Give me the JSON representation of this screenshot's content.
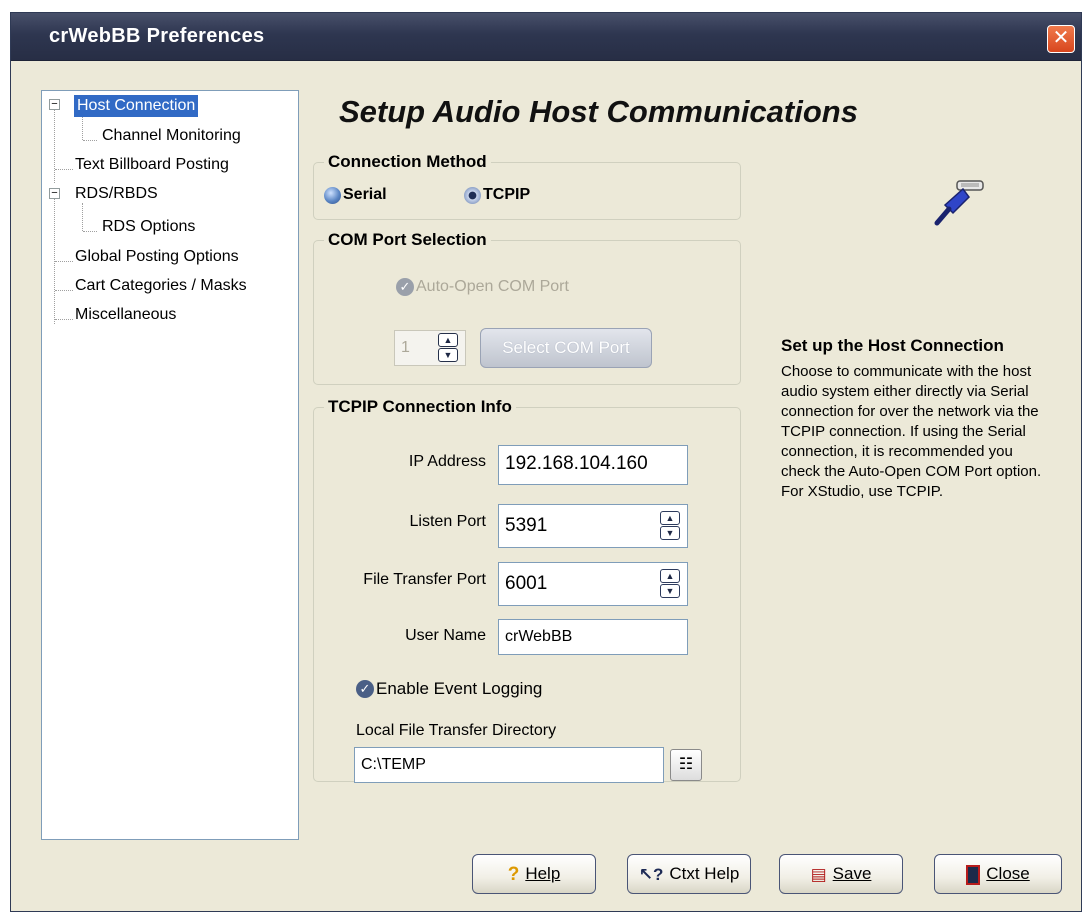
{
  "window": {
    "title": "crWebBB Preferences",
    "close_glyph": "✕"
  },
  "tree": {
    "items": [
      {
        "label": "Host Connection",
        "selected": true
      },
      {
        "label": "Channel Monitoring"
      },
      {
        "label": "Text Billboard Posting"
      },
      {
        "label": "RDS/RBDS"
      },
      {
        "label": "RDS Options"
      },
      {
        "label": "Global Posting Options"
      },
      {
        "label": "Cart Categories / Masks"
      },
      {
        "label": "Miscellaneous"
      }
    ]
  },
  "heading": "Setup Audio Host Communications",
  "connection": {
    "legend": "Connection Method",
    "serial_label": "Serial",
    "tcpip_label": "TCPIP",
    "selected": "TCPIP"
  },
  "com": {
    "legend": "COM Port Selection",
    "auto_open_label": "Auto-Open COM Port",
    "port_value": "1",
    "select_button": "Select COM Port"
  },
  "tcpip": {
    "legend": "TCPIP Connection Info",
    "ip_label": "IP Address",
    "ip_value": "192.168.104.160",
    "listen_label": "Listen Port",
    "listen_value": "5391",
    "ftp_label": "File Transfer Port",
    "ftp_value": "6001",
    "user_label": "User Name",
    "user_value": "crWebBB",
    "logging_label": "Enable Event Logging",
    "dir_label": "Local File Transfer Directory",
    "dir_value": "C:\\TEMP"
  },
  "help": {
    "title": "Set up the Host Connection",
    "body": "Choose to communicate with the host audio system either directly via Serial connection for over the network via the TCPIP connection. If using the Serial connection, it is recommended you check the Auto-Open COM Port option. For XStudio, use TCPIP."
  },
  "buttons": {
    "help": "Help",
    "ctxt_help": "Ctxt Help",
    "save": "Save",
    "close": "Close"
  },
  "icons": {
    "help": "help-question-icon",
    "ctxt_help": "context-help-pointer-icon",
    "save": "save-document-icon",
    "close": "close-door-icon",
    "browse": "folder-browse-icon",
    "illustration": "network-cable-plug-icon"
  },
  "colors": {
    "titlebar": "#2e3650",
    "selection": "#316ac5",
    "close_button": "#d8461e"
  }
}
